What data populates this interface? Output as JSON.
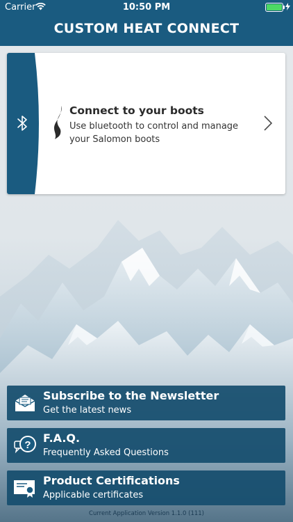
{
  "status_bar": {
    "carrier": "Carrier",
    "time": "10:50 PM",
    "battery_color": "#4cd964"
  },
  "header": {
    "title": "CUSTOM HEAT CONNECT",
    "color": "#1a5b80"
  },
  "connect_card": {
    "title": "Connect to your boots",
    "subtitle": "Use bluetooth to control and manage your Salomon boots",
    "icons": [
      "bluetooth-icon",
      "flame-icon",
      "chevron-right-icon"
    ]
  },
  "menu": [
    {
      "title": "Subscribe to the Newsletter",
      "subtitle": "Get the latest news",
      "icon": "envelope-icon"
    },
    {
      "title": "F.A.Q.",
      "subtitle": "Frequently Asked Questions",
      "icon": "question-bubble-icon"
    },
    {
      "title": "Product Certifications",
      "subtitle": "Applicable certificates",
      "icon": "certificate-icon"
    }
  ],
  "footer": {
    "version_text": "Current Application Version 1.1.0 (111)"
  }
}
